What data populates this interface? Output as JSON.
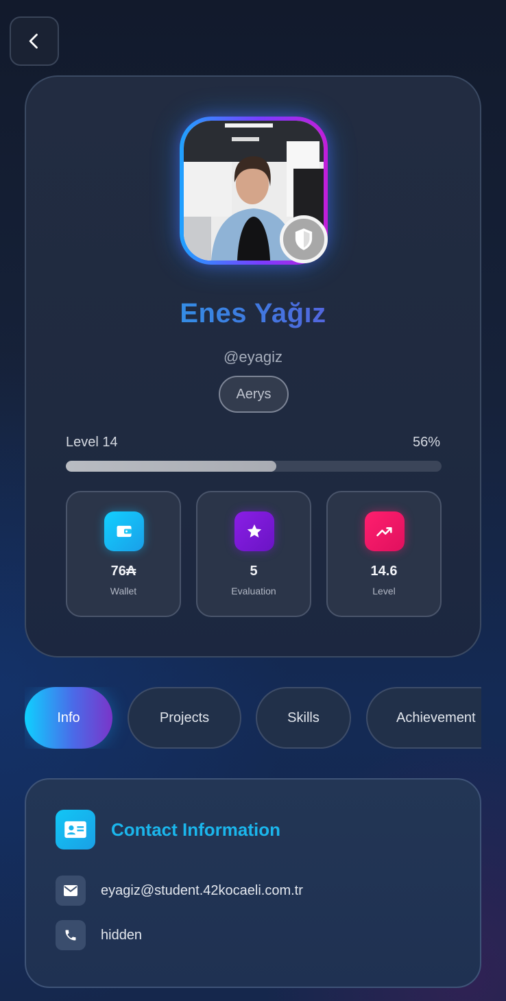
{
  "header": {
    "back_icon": "chevron-left-icon"
  },
  "profile": {
    "name": "Enes Yağız",
    "username": "@eyagiz",
    "campus": "Aerys",
    "avatar_badge_icon": "shield-icon",
    "level_label": "Level 14",
    "level_percent_label": "56%",
    "level_progress": 0.56,
    "stats": [
      {
        "value": "76₳",
        "label": "Wallet",
        "icon": "wallet-icon",
        "color": "#1cc4f4"
      },
      {
        "value": "5",
        "label": "Evaluation",
        "icon": "star-icon",
        "color": "#7a1ed8"
      },
      {
        "value": "14.6",
        "label": "Level",
        "icon": "trending-up-icon",
        "color": "#f0186a"
      }
    ]
  },
  "tabs": [
    {
      "label": "Info",
      "active": true
    },
    {
      "label": "Projects",
      "active": false
    },
    {
      "label": "Skills",
      "active": false
    },
    {
      "label": "Achievement",
      "active": false
    }
  ],
  "contact": {
    "title": "Contact Information",
    "icon": "contact-card-icon",
    "email": "eyagiz@student.42kocaeli.com.tr",
    "phone": "hidden"
  }
}
